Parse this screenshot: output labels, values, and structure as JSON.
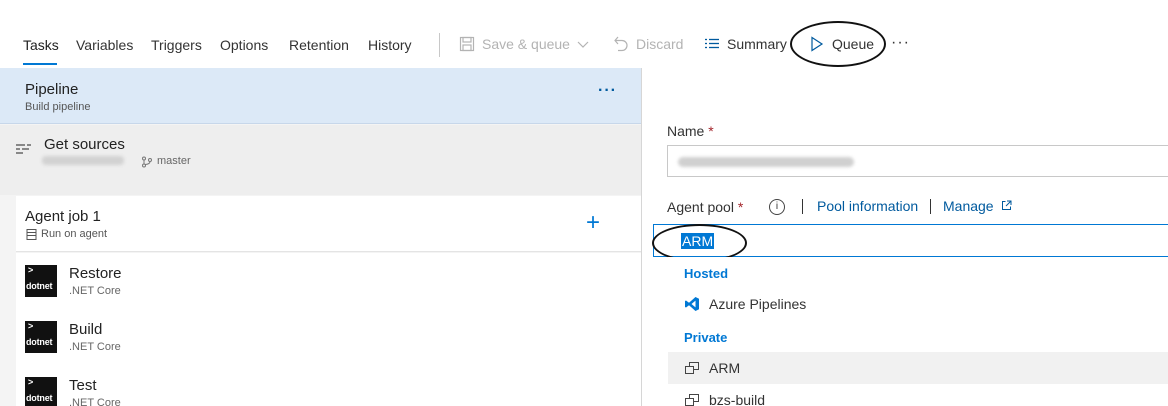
{
  "toolbar": {
    "tabs": [
      "Tasks",
      "Variables",
      "Triggers",
      "Options",
      "Retention",
      "History"
    ],
    "save_queue": "Save & queue",
    "discard": "Discard",
    "summary": "Summary",
    "queue": "Queue",
    "more": "···"
  },
  "pipeline": {
    "title": "Pipeline",
    "subtitle": "Build pipeline",
    "more": "···"
  },
  "get_sources": {
    "title": "Get sources",
    "branch": "master"
  },
  "agent_job": {
    "title": "Agent job 1",
    "subtitle": "Run on agent",
    "add": "+"
  },
  "tasks": [
    {
      "title": "Restore",
      "subtitle": ".NET Core",
      "logo": "dotnet",
      "logo_prompt": ">"
    },
    {
      "title": "Build",
      "subtitle": ".NET Core",
      "logo": "dotnet",
      "logo_prompt": ">"
    },
    {
      "title": "Test",
      "subtitle": ".NET Core",
      "logo": "dotnet",
      "logo_prompt": ">"
    }
  ],
  "details": {
    "name_label": "Name",
    "required_mark": "*",
    "agent_pool_label": "Agent pool",
    "info": "i",
    "pool_information": "Pool information",
    "manage": "Manage",
    "agent_pool_value": "ARM",
    "dropdown": {
      "hosted_header": "Hosted",
      "hosted_items": [
        "Azure Pipelines"
      ],
      "private_header": "Private",
      "private_items": [
        "ARM",
        "bzs-build"
      ]
    }
  },
  "colors": {
    "accent": "#0078d4",
    "link": "#005a9e",
    "selected_panel": "#dce9f7",
    "required": "#a4262c"
  }
}
